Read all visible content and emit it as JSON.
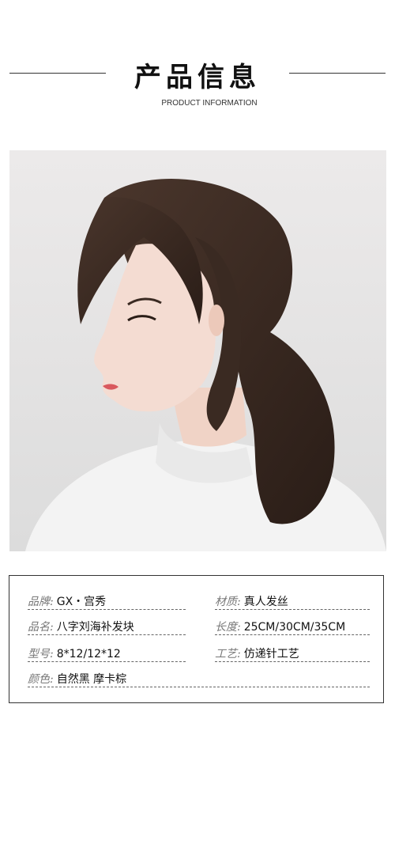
{
  "header": {
    "title": "产品信息",
    "subtitle": "PRODUCT INFORMATION"
  },
  "photo": {
    "subject": "woman-with-ponytail",
    "colors": {
      "background": "#e8e8e8",
      "hair": "#3a2a22",
      "skin": "#f4dcd2",
      "sweater": "#f5f5f5"
    }
  },
  "info": {
    "rows": [
      {
        "label": "品牌:",
        "value": "GX・宫秀"
      },
      {
        "label": "材质:",
        "value": "真人发丝"
      },
      {
        "label": "品名:",
        "value": "八字刘海补发块"
      },
      {
        "label": "长度:",
        "value": "25CM/30CM/35CM"
      },
      {
        "label": "型号:",
        "value": "8*12/12*12"
      },
      {
        "label": "工艺:",
        "value": "仿递针工艺"
      },
      {
        "label": "颜色:",
        "value": "自然黑 摩卡棕"
      }
    ]
  }
}
